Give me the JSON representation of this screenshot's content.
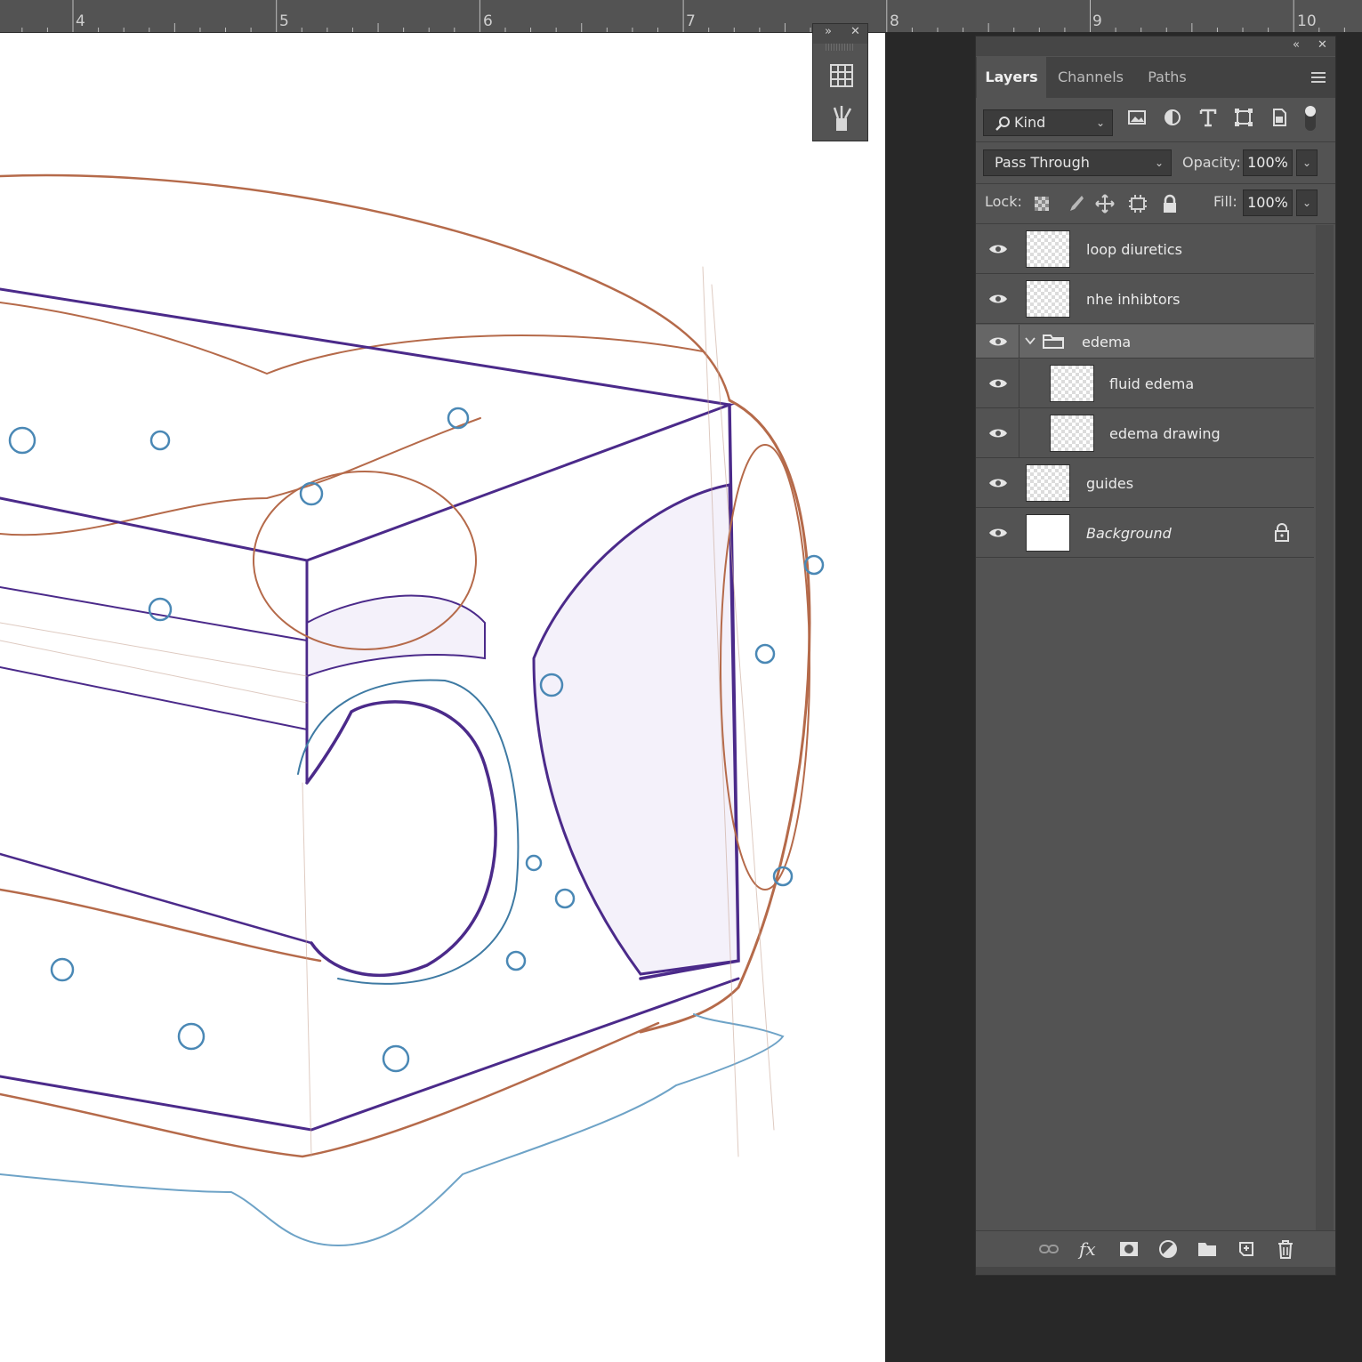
{
  "ruler": {
    "marks": [
      "4",
      "5",
      "6",
      "7",
      "8",
      "9",
      "10"
    ]
  },
  "canvas": {
    "description_icons": [
      "anatomy-sketch"
    ]
  },
  "minibar": {
    "icons": [
      "expand-icon",
      "close-icon",
      "grid-icon",
      "brushes-icon"
    ]
  },
  "panel": {
    "tabs": [
      {
        "label": "Layers",
        "active": true
      },
      {
        "label": "Channels",
        "active": false
      },
      {
        "label": "Paths",
        "active": false
      }
    ],
    "filter": {
      "kind_label": "Kind",
      "icons": [
        "image-filter-icon",
        "adjustment-filter-icon",
        "type-filter-icon",
        "shape-filter-icon",
        "smart-object-filter-icon",
        "filter-toggle-icon"
      ]
    },
    "blend_mode": "Pass Through",
    "opacity_label": "Opacity:",
    "opacity_value": "100%",
    "lock_label": "Lock:",
    "fill_label": "Fill:",
    "fill_value": "100%",
    "layers": [
      {
        "name": "loop diuretics",
        "visible": true
      },
      {
        "name": "nhe inhibtors",
        "visible": true
      },
      {
        "name": "edema",
        "visible": true,
        "group": true,
        "expanded": true
      },
      {
        "name": "fluid edema",
        "visible": true
      },
      {
        "name": "edema drawing",
        "visible": true
      },
      {
        "name": "guides",
        "visible": true
      },
      {
        "name": "Background",
        "visible": true,
        "locked": true
      }
    ],
    "footer_icons": [
      "link-icon",
      "fx-icon",
      "mask-icon",
      "adjustment-icon",
      "folder-icon",
      "new-layer-icon",
      "trash-icon"
    ],
    "colors": {
      "panel": "#535353",
      "selected": "#666666",
      "dark": "#282828"
    }
  }
}
